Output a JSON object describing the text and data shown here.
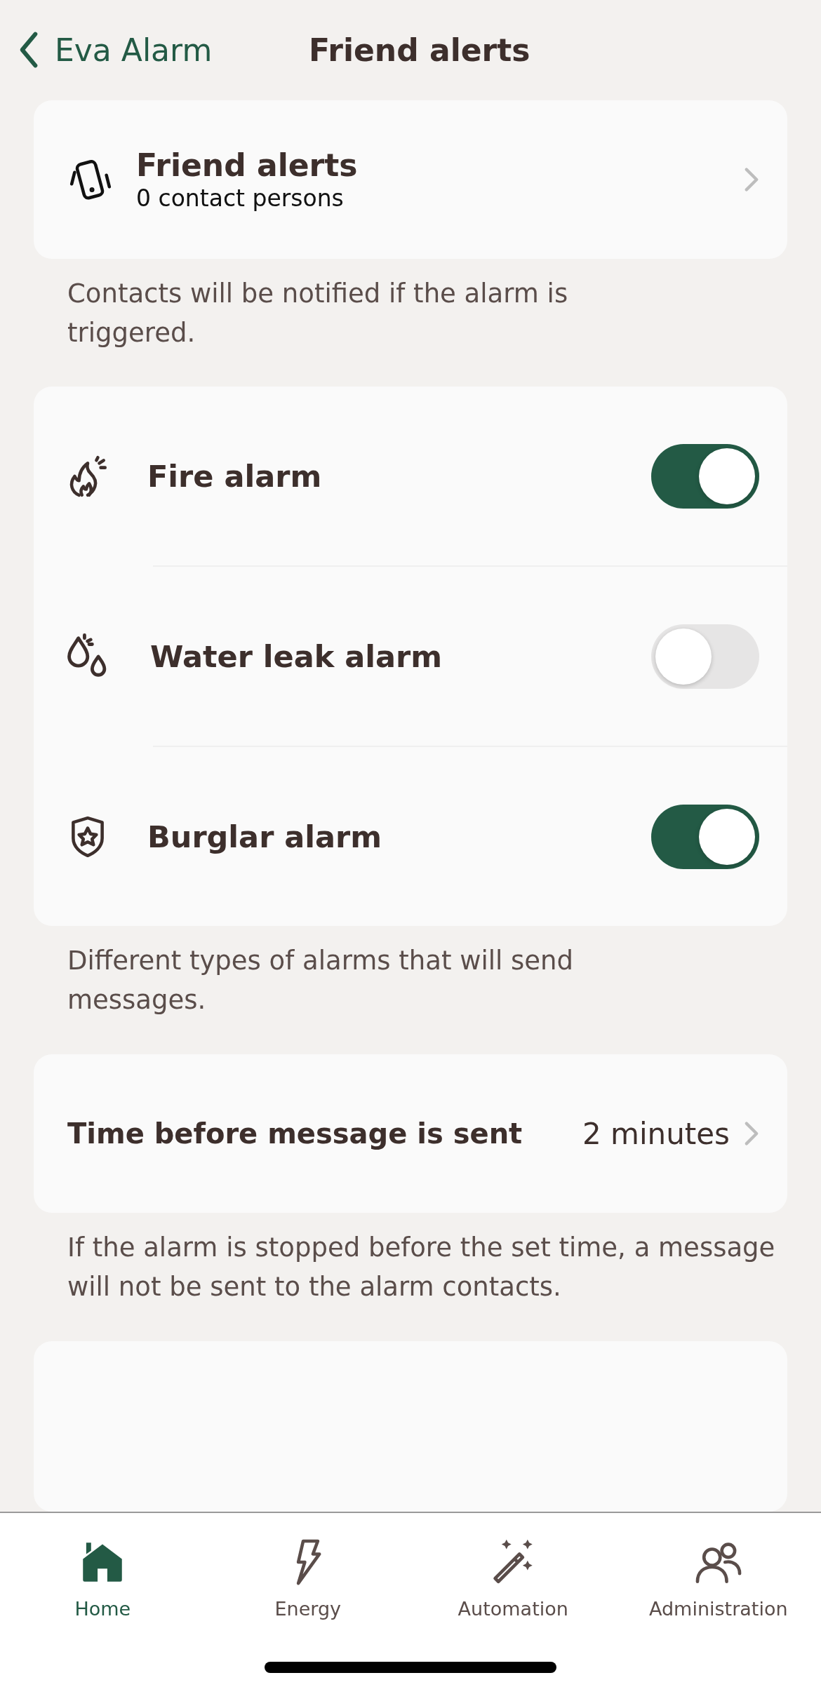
{
  "header": {
    "back_label": "Eva Alarm",
    "title": "Friend alerts"
  },
  "friend_alerts": {
    "title": "Friend alerts",
    "subtitle": "0 contact persons",
    "note": "Contacts will be notified if the alarm is triggered."
  },
  "alarm_types": {
    "items": [
      {
        "kind": "fire",
        "label": "Fire alarm",
        "on": true
      },
      {
        "kind": "water",
        "label": "Water leak alarm",
        "on": false
      },
      {
        "kind": "burglar",
        "label": "Burglar alarm",
        "on": true
      }
    ],
    "note": "Different types of alarms that will send messages."
  },
  "delay": {
    "label": "Time before message is sent",
    "value": "2 minutes",
    "note": "If the alarm is stopped before the set time, a message will not be sent to the alarm contacts."
  },
  "tab_bar": {
    "tabs": [
      {
        "kind": "home",
        "label": "Home",
        "selected": true
      },
      {
        "kind": "energy",
        "label": "Energy",
        "selected": false
      },
      {
        "kind": "automation",
        "label": "Automation",
        "selected": false
      },
      {
        "kind": "admin",
        "label": "Administration",
        "selected": false
      }
    ]
  }
}
